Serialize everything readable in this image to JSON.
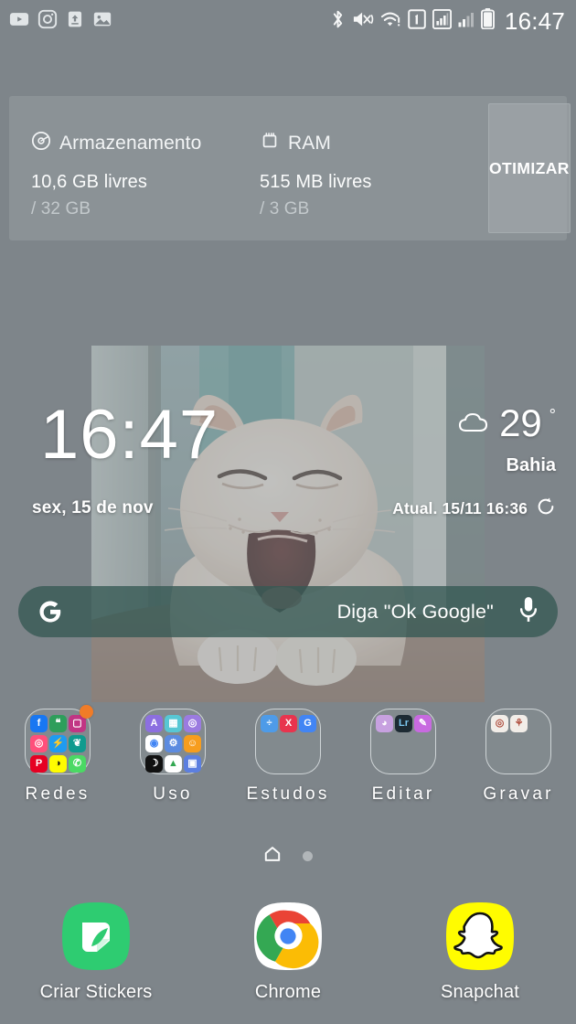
{
  "status_bar": {
    "time": "16:47",
    "left_icons": [
      {
        "name": "youtube-icon",
        "label": "YouTube"
      },
      {
        "name": "instagram-icon",
        "label": "Instagram"
      },
      {
        "name": "upload-icon",
        "label": "Upload"
      },
      {
        "name": "gallery-icon",
        "label": "Gallery"
      }
    ],
    "right_icons": [
      {
        "name": "bluetooth-icon",
        "label": "Bluetooth"
      },
      {
        "name": "mute-vibrate-icon",
        "label": "Sound off"
      },
      {
        "name": "wifi-alert-icon",
        "label": "Wi-Fi"
      },
      {
        "name": "sim-1-icon",
        "label": "SIM 1"
      },
      {
        "name": "signal-bars-icon",
        "label": "Signal 1"
      },
      {
        "name": "signal-bars-2-icon",
        "label": "Signal 2"
      },
      {
        "name": "battery-icon",
        "label": "Battery"
      }
    ]
  },
  "system_widget": {
    "storage": {
      "icon": "storage-disc-icon",
      "title": "Armazenamento",
      "free": "10,6 GB livres",
      "total": "/ 32 GB"
    },
    "ram": {
      "icon": "ram-chip-icon",
      "title": "RAM",
      "free": "515 MB livres",
      "total": "/ 3 GB"
    },
    "optimize_label": "OTIMIZAR"
  },
  "clock_widget": {
    "time": "16:47",
    "date": "sex, 15 de nov",
    "weather": {
      "icon": "cloud-icon",
      "temperature": "29",
      "degree_symbol": "°",
      "city": "Bahia",
      "updated": "Atual. 15/11 16:36",
      "refresh_icon": "refresh-icon"
    }
  },
  "search_bar": {
    "logo_icon": "google-g-icon",
    "placeholder": "Diga \"Ok Google\"",
    "mic_icon": "microphone-icon"
  },
  "folders": [
    {
      "name": "Redes",
      "has_notification": true,
      "apps": [
        {
          "name": "facebook-icon",
          "bg": "#1877F2",
          "glyph": "f",
          "fg": "#ffffff"
        },
        {
          "name": "whatsapp-business-icon",
          "bg": "#2E9E5B",
          "glyph": "❝",
          "fg": "#ffffff"
        },
        {
          "name": "instagram-icon",
          "bg": "#C13584",
          "glyph": "▢",
          "fg": "#ffffff"
        },
        {
          "name": "photo-editor-icon",
          "bg": "#FF4F7B",
          "glyph": "◎",
          "fg": "#ffffff"
        },
        {
          "name": "messenger-icon",
          "bg": "#1E9BF0",
          "glyph": "⚡",
          "fg": "#ffffff"
        },
        {
          "name": "butterfly-icon",
          "bg": "#0F9B8E",
          "glyph": "❦",
          "fg": "#ffffff"
        },
        {
          "name": "pinterest-icon",
          "bg": "#E60023",
          "glyph": "P",
          "fg": "#ffffff"
        },
        {
          "name": "snapchat-icon",
          "bg": "#FFFC00",
          "glyph": "◑",
          "fg": "#111111"
        },
        {
          "name": "whatsapp-icon",
          "bg": "#4BD964",
          "glyph": "✆",
          "fg": "#ffffff"
        }
      ]
    },
    {
      "name": "Uso",
      "has_notification": false,
      "apps": [
        {
          "name": "amino-icon",
          "bg": "#8C6FE0",
          "glyph": "A",
          "fg": "#ffffff"
        },
        {
          "name": "calendar-icon",
          "bg": "#57C7D4",
          "glyph": "▦",
          "fg": "#ffffff"
        },
        {
          "name": "camera-icon",
          "bg": "#9B7BE0",
          "glyph": "◎",
          "fg": "#ffffff"
        },
        {
          "name": "chrome-icon",
          "bg": "#ffffff",
          "glyph": "◉",
          "fg": "#4285F4"
        },
        {
          "name": "settings-icon",
          "bg": "#5C8BE0",
          "glyph": "⚙",
          "fg": "#ffffff"
        },
        {
          "name": "contacts-icon",
          "bg": "#F79D1E",
          "glyph": "☺",
          "fg": "#ffffff"
        },
        {
          "name": "moon-icon",
          "bg": "#111111",
          "glyph": "☽",
          "fg": "#ffffff"
        },
        {
          "name": "google-drive-icon",
          "bg": "#ffffff",
          "glyph": "▲",
          "fg": "#34A853"
        },
        {
          "name": "screen-recorder-icon",
          "bg": "#5C7FE0",
          "glyph": "▣",
          "fg": "#ffffff"
        }
      ]
    },
    {
      "name": "Estudos",
      "has_notification": false,
      "apps": [
        {
          "name": "photomath-icon",
          "bg": "#4E9BE8",
          "glyph": "÷",
          "fg": "#ffffff"
        },
        {
          "name": "excel-icon",
          "bg": "#E8344E",
          "glyph": "X",
          "fg": "#ffffff"
        },
        {
          "name": "google-translate-icon",
          "bg": "#4285F4",
          "glyph": "G",
          "fg": "#ffffff"
        }
      ]
    },
    {
      "name": "Editar",
      "has_notification": false,
      "apps": [
        {
          "name": "color-wheel-icon",
          "bg": "#C7A1E0",
          "glyph": "◕",
          "fg": "#ffffff"
        },
        {
          "name": "lightroom-icon",
          "bg": "#1D2A33",
          "glyph": "Lr",
          "fg": "#7BC8F0"
        },
        {
          "name": "picsart-icon",
          "bg": "#C86AE0",
          "glyph": "✎",
          "fg": "#ffffff"
        }
      ]
    },
    {
      "name": "Gravar",
      "has_notification": false,
      "apps": [
        {
          "name": "recorder-icon",
          "bg": "#F2EDE8",
          "glyph": "◎",
          "fg": "#B05040"
        },
        {
          "name": "voice-memo-icon",
          "bg": "#F2EDE8",
          "glyph": "⚘",
          "fg": "#B05040"
        }
      ]
    }
  ],
  "page_indicator": {
    "home_icon": "home-icon",
    "pages": 2,
    "current_page": 1
  },
  "dock": [
    {
      "name": "Criar Stickers",
      "icon": "sticker-maker-icon"
    },
    {
      "name": "Chrome",
      "icon": "chrome-icon"
    },
    {
      "name": "Snapchat",
      "icon": "snapchat-icon"
    }
  ],
  "colors": {
    "background": "#7e868a",
    "search_pill": "#345853",
    "notification_dot": "#f07c28",
    "text_primary": "#ffffff",
    "text_muted": "#c3c9cc"
  }
}
